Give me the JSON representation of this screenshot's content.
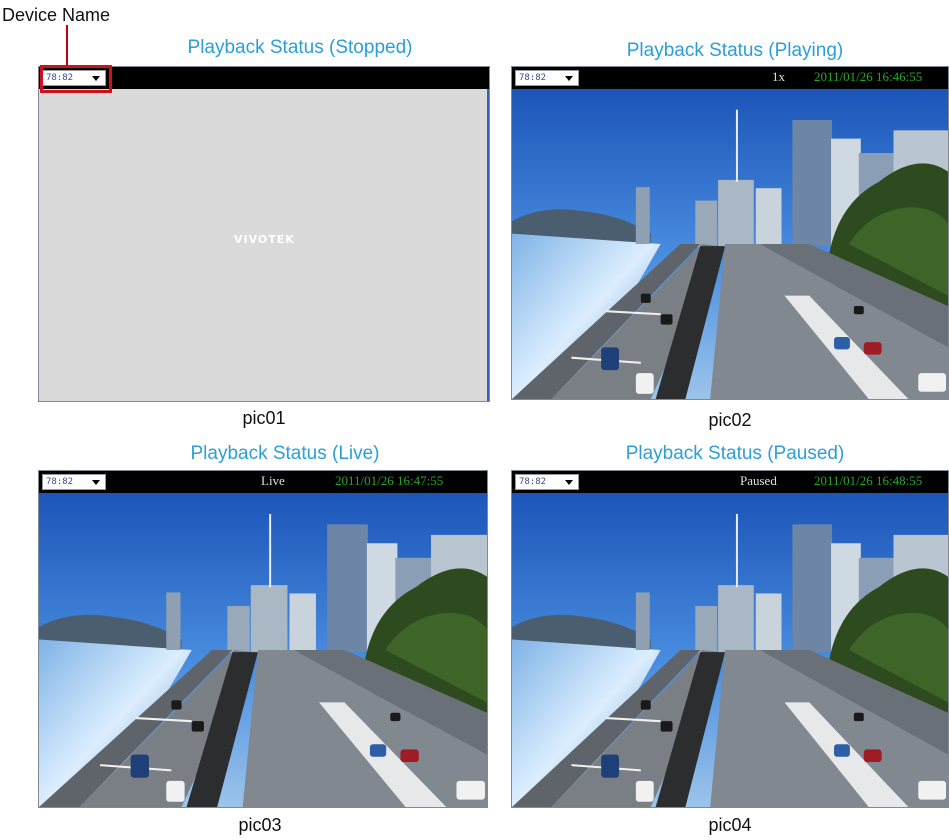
{
  "callout": {
    "label": "Device Name"
  },
  "panels": [
    {
      "title": "Playback Status (Stopped)",
      "caption": "pic01",
      "device": "78:82",
      "status": "",
      "timestamp": "",
      "logo": "VIVOTEK"
    },
    {
      "title": "Playback Status (Playing)",
      "caption": "pic02",
      "device": "78:82",
      "status": "1x",
      "timestamp": "2011/01/26   16:46:55"
    },
    {
      "title": "Playback Status (Live)",
      "caption": "pic03",
      "device": "78:82",
      "status": "Live",
      "timestamp": "2011/01/26   16:47:55"
    },
    {
      "title": "Playback Status (Paused)",
      "caption": "pic04",
      "device": "78:82",
      "status": "Paused",
      "timestamp": "2011/01/26   16:48:55"
    }
  ],
  "colors": {
    "title": "#2a9fd8",
    "callout": "#d0101c",
    "timestamp": "#25a825",
    "topbar": "#000000"
  },
  "icons": {
    "dropdown": "chevron-down-icon"
  }
}
